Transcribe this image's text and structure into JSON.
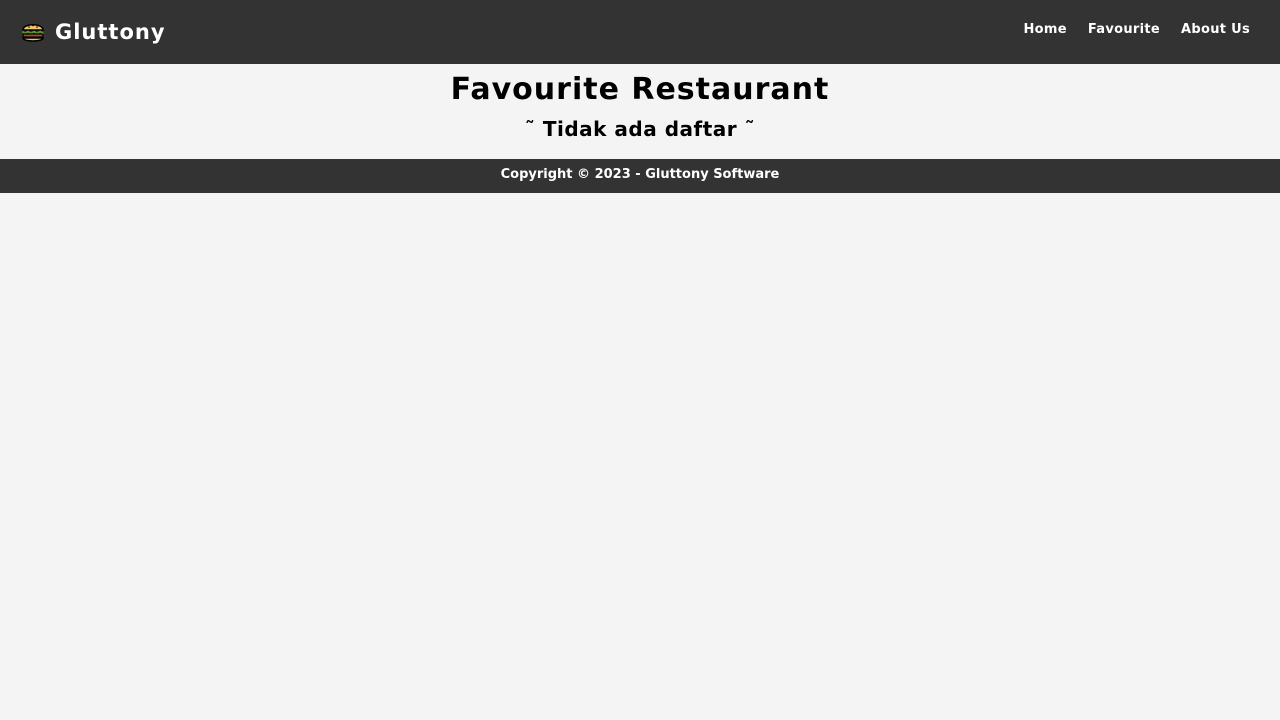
{
  "header": {
    "brand_name": "Gluttony",
    "brand_icon": "burger-icon",
    "nav": [
      {
        "label": "Home"
      },
      {
        "label": "Favourite"
      },
      {
        "label": "About Us"
      }
    ]
  },
  "main": {
    "title": "Favourite Restaurant",
    "empty_message": "˜ Tidak ada daftar ˜"
  },
  "footer": {
    "copyright": "Copyright © 2023 - Gluttony Software"
  },
  "colors": {
    "navbar_bg": "#333333",
    "page_bg": "#f4f4f4",
    "text_light": "#ffffff",
    "text_dark": "#000000"
  }
}
